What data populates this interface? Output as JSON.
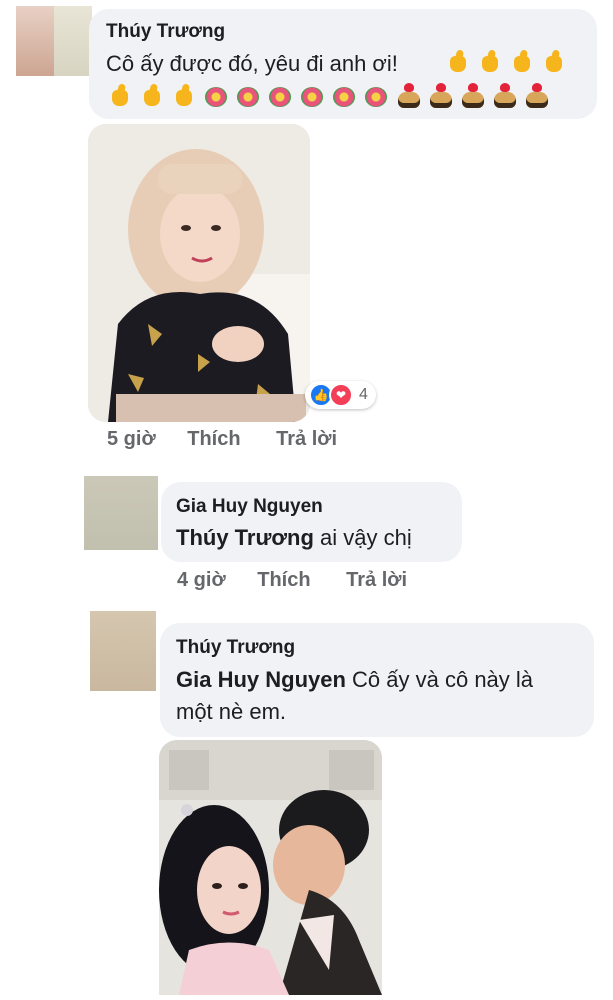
{
  "colors": {
    "bubble": "#f0f2f5",
    "secondary_text": "#65676b",
    "like_blue": "#1877f2",
    "love_red": "#f33e58"
  },
  "comments": [
    {
      "author": "Thúy Trương",
      "text": "Cô ấy được đó, yêu đi anh ơi!",
      "emojis_line1": [
        "thumbs-up",
        "thumbs-up",
        "thumbs-up",
        "thumbs-up"
      ],
      "emojis_line2": [
        "thumbs-up",
        "thumbs-up",
        "thumbs-up",
        "flower",
        "flower",
        "flower",
        "flower",
        "flower",
        "flower",
        "couple-heart",
        "couple-heart",
        "couple-heart",
        "couple-heart",
        "couple-heart"
      ],
      "reactions": {
        "count": "4",
        "icons": [
          "like-icon",
          "love-icon"
        ]
      },
      "time": "5 giờ",
      "like_label": "Thích",
      "reply_label": "Trả lời"
    },
    {
      "author": "Gia Huy Nguyen",
      "mention": "Thúy Trương",
      "text": " ai vậy chị",
      "time": "4 giờ",
      "like_label": "Thích",
      "reply_label": "Trả lời"
    },
    {
      "author": "Thúy Trương",
      "mention": "Gia Huy Nguyen",
      "text_line1": " Cô ấy và cô này là",
      "text_line2": "một nè em."
    }
  ]
}
